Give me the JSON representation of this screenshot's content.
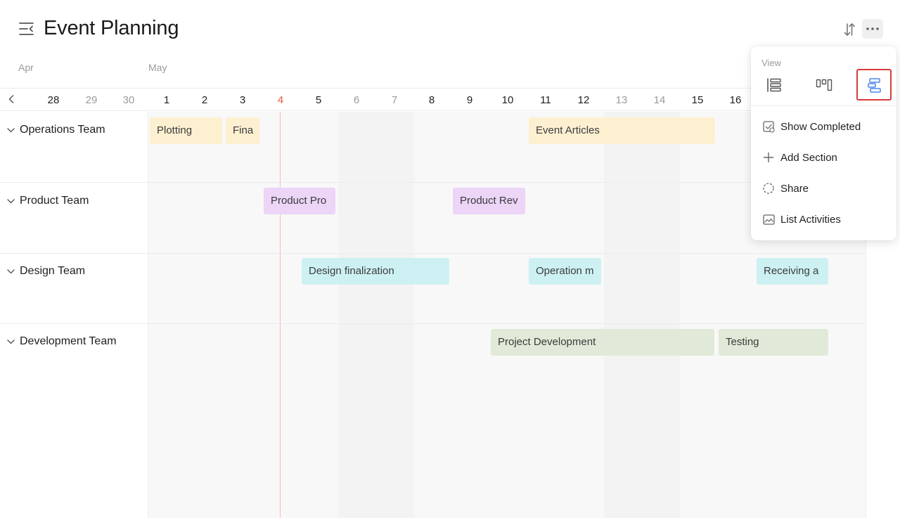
{
  "header": {
    "title": "Event Planning",
    "icons": [
      "sidebar-toggle-icon",
      "sort-icon",
      "more-icon"
    ]
  },
  "timeline": {
    "months": [
      "Apr",
      "May"
    ],
    "days": [
      {
        "label": "28",
        "weekend": false,
        "today": false
      },
      {
        "label": "29",
        "weekend": true,
        "today": false
      },
      {
        "label": "30",
        "weekend": true,
        "today": false
      },
      {
        "label": "1",
        "weekend": false,
        "today": false
      },
      {
        "label": "2",
        "weekend": false,
        "today": false
      },
      {
        "label": "3",
        "weekend": false,
        "today": false
      },
      {
        "label": "4",
        "weekend": false,
        "today": true
      },
      {
        "label": "5",
        "weekend": false,
        "today": false
      },
      {
        "label": "6",
        "weekend": true,
        "today": false
      },
      {
        "label": "7",
        "weekend": true,
        "today": false
      },
      {
        "label": "8",
        "weekend": false,
        "today": false
      },
      {
        "label": "9",
        "weekend": false,
        "today": false
      },
      {
        "label": "10",
        "weekend": false,
        "today": false
      },
      {
        "label": "11",
        "weekend": false,
        "today": false
      },
      {
        "label": "12",
        "weekend": false,
        "today": false
      },
      {
        "label": "13",
        "weekend": true,
        "today": false
      },
      {
        "label": "14",
        "weekend": true,
        "today": false
      },
      {
        "label": "15",
        "weekend": false,
        "today": false
      },
      {
        "label": "16",
        "weekend": false,
        "today": false
      }
    ]
  },
  "sections": [
    {
      "label": "Operations Team",
      "tasks": [
        {
          "label": "Plotting",
          "color": "#fcf0d1"
        },
        {
          "label": "Fina",
          "color": "#fcf0d1"
        },
        {
          "label": "Event Articles",
          "color": "#fcf0d1"
        }
      ]
    },
    {
      "label": "Product Team",
      "tasks": [
        {
          "label": "Product Pro",
          "color": "#ecd5f7"
        },
        {
          "label": "Product Rev",
          "color": "#ecd5f7"
        }
      ]
    },
    {
      "label": "Design Team",
      "tasks": [
        {
          "label": "Design finalization",
          "color": "#cdf1f3"
        },
        {
          "label": "Operation m",
          "color": "#cdf1f3"
        },
        {
          "label": "Receiving a",
          "color": "#cdf1f3"
        }
      ]
    },
    {
      "label": "Development Team",
      "tasks": [
        {
          "label": "Project Development",
          "color": "#e1ead8"
        },
        {
          "label": "Testing",
          "color": "#e1ead8"
        }
      ]
    }
  ],
  "menu": {
    "caption": "View",
    "views": [
      {
        "icon": "list-view-icon",
        "selected": false
      },
      {
        "icon": "board-view-icon",
        "selected": false
      },
      {
        "icon": "timeline-view-icon",
        "selected": true
      }
    ],
    "items": [
      {
        "label": "Show Completed",
        "icon": "check-square-icon"
      },
      {
        "label": "Add Section",
        "icon": "plus-icon"
      },
      {
        "label": "Share",
        "icon": "share-circle-icon"
      },
      {
        "label": "List Activities",
        "icon": "activity-image-icon"
      }
    ]
  },
  "colors": {
    "today": "#e35c41",
    "selected_outline": "#d93a3a",
    "view_active": "#4a86e8"
  }
}
